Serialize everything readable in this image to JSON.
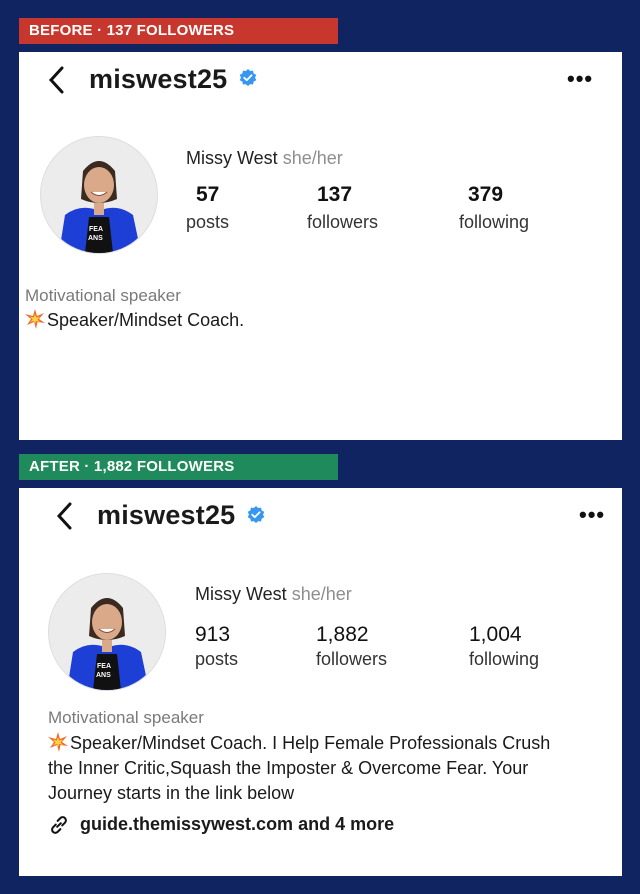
{
  "before": {
    "banner": "BEFORE · 137 FOLLOWERS",
    "username": "miswest25",
    "name": "Missy West",
    "pronouns": "she/her",
    "stats": [
      {
        "value": "57",
        "label": "posts"
      },
      {
        "value": "137",
        "label": "followers"
      },
      {
        "value": "379",
        "label": "following"
      }
    ],
    "category": "Motivational speaker",
    "bio_line1": "Speaker/Mindset Coach."
  },
  "after": {
    "banner": "AFTER · 1,882 FOLLOWERS",
    "username": "miswest25",
    "name": "Missy West",
    "pronouns": "she/her",
    "stats": [
      {
        "value": "913",
        "label": "posts"
      },
      {
        "value": "1,882",
        "label": "followers"
      },
      {
        "value": "1,004",
        "label": "following"
      }
    ],
    "category": "Motivational speaker",
    "bio_line1": "Speaker/Mindset Coach. I Help Female Professionals Crush",
    "bio_line2": "the Inner Critic,Squash the Imposter & Overcome Fear. Your",
    "bio_line3": "Journey starts in the link below",
    "link": "guide.themissywest.com and 4 more"
  },
  "colors": {
    "page_bg": "#0f2461",
    "before_banner": "#c8372d",
    "after_banner": "#1f8a5c",
    "verified": "#3797f0"
  },
  "icons": [
    "back-chevron-icon",
    "verified-badge-icon",
    "more-options-icon",
    "sparkle-emoji-icon",
    "link-chain-icon"
  ]
}
